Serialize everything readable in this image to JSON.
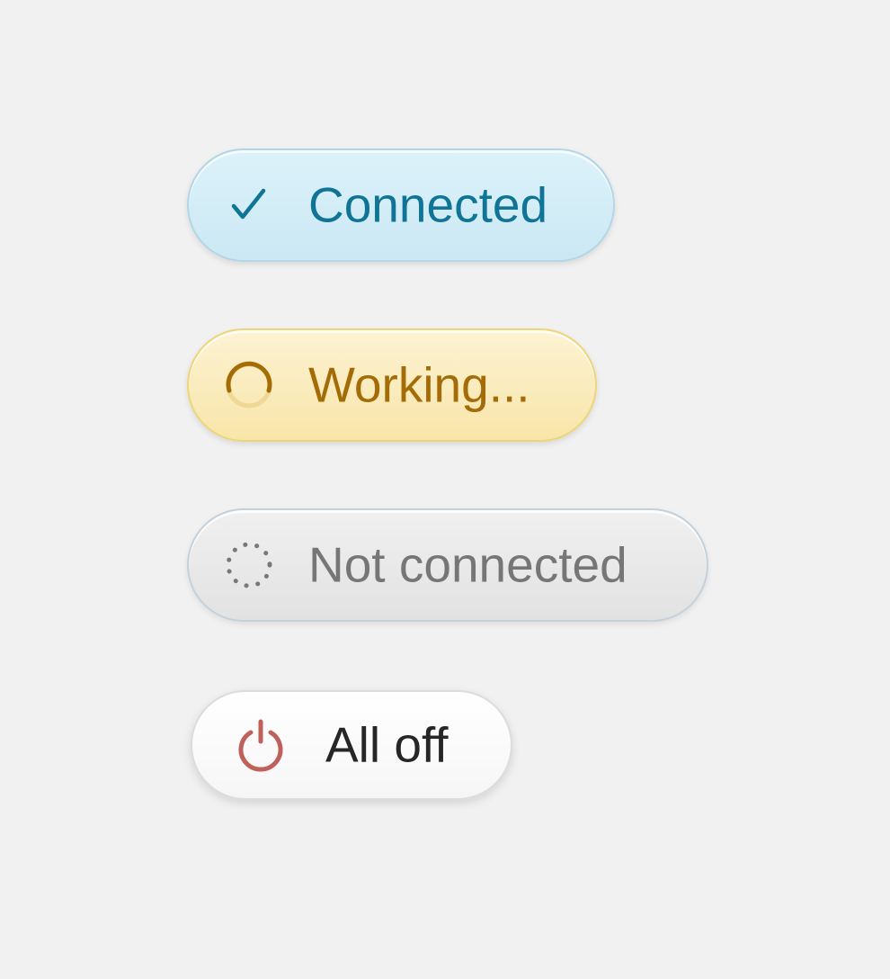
{
  "status_buttons": [
    {
      "id": "connected",
      "label": "Connected",
      "icon": "checkmark-icon",
      "text_color": "#0f7496",
      "background": "#d5eef8"
    },
    {
      "id": "working",
      "label": "Working...",
      "icon": "spinner-icon",
      "text_color": "#a46c07",
      "background": "#fbecbd"
    },
    {
      "id": "not-connected",
      "label": "Not connected",
      "icon": "dotted-circle-icon",
      "text_color": "#767676",
      "background": "#e9e9e9"
    },
    {
      "id": "all-off",
      "label": "All off",
      "icon": "power-icon",
      "text_color": "#262626",
      "icon_color": "#c0605a",
      "background": "#fbfbfb"
    }
  ]
}
